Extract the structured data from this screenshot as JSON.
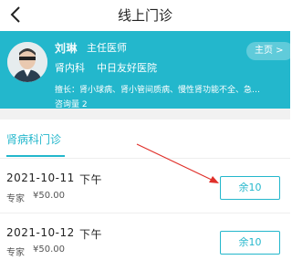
{
  "header": {
    "title": "线上门诊"
  },
  "doctor": {
    "name": "刘琳",
    "title": "主任医师",
    "department": "肾内科",
    "hospital": "中日友好医院",
    "specialty": "擅长：肾小球病、肾小管间质病、慢性肾功能不全、急…",
    "consult_count": "咨询量 2",
    "home_label": "主页 >"
  },
  "tab": {
    "label": "肾病科门诊"
  },
  "slots": [
    {
      "date": "2021-10-11",
      "period": "下午",
      "type": "专家",
      "price": "¥50.00",
      "remaining": "余10"
    },
    {
      "date": "2021-10-12",
      "period": "下午",
      "type": "专家",
      "price": "¥50.00",
      "remaining": "余10"
    }
  ],
  "colors": {
    "accent": "#23b7cc",
    "annotation": "#e0302a",
    "page_bg": "#ffffff"
  }
}
